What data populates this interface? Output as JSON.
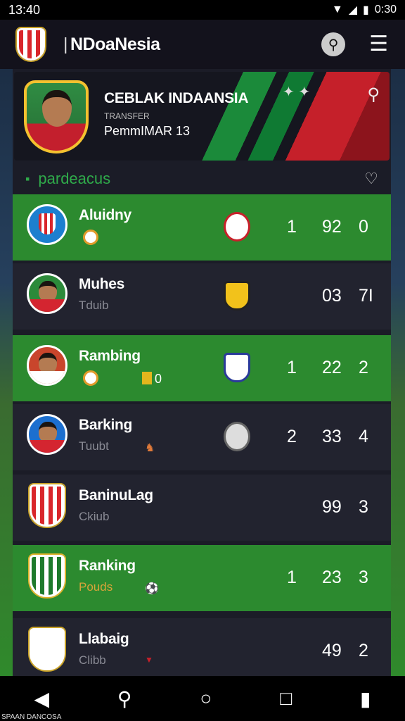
{
  "status": {
    "time": "13:40",
    "battery": "0:30"
  },
  "appbar": {
    "title": "NDoaNesia"
  },
  "hero": {
    "title": "CEBLAK INDAANSIA",
    "subtitle": "TRANSFER",
    "line": "PemmIMAR 13"
  },
  "section": {
    "title": "pardeacus"
  },
  "rows": [
    {
      "name": "Aluidny",
      "sub": "",
      "stats": [
        "1",
        "92",
        "0"
      ]
    },
    {
      "name": "Muhes",
      "sub": "Tduib",
      "stats": [
        "",
        "03",
        "7I"
      ]
    },
    {
      "name": "Rambing",
      "sub": "",
      "tag": "0",
      "stats": [
        "1",
        "22",
        "2"
      ]
    },
    {
      "name": "Barking",
      "sub": "Tuubt",
      "stats": [
        "2",
        "33",
        "4"
      ]
    },
    {
      "name": "BaninuLag",
      "sub": "Ckiub",
      "stats": [
        "",
        "99",
        "3"
      ]
    },
    {
      "name": "Ranking",
      "sub": "Pouds",
      "stats": [
        "1",
        "23",
        "3"
      ]
    },
    {
      "name": "Llabaig",
      "sub": "Clibb",
      "stats": [
        "",
        "49",
        "2"
      ]
    }
  ],
  "navbar": {
    "caption": "SPAAN DANCOSA"
  },
  "icons": [
    "search-icon",
    "menu-icon",
    "heart-icon",
    "back-icon",
    "home-icon",
    "recents-icon"
  ],
  "colors": {
    "accent_green": "#2c8a2f",
    "row_dark": "#22232f",
    "appbar": "#13121c"
  }
}
